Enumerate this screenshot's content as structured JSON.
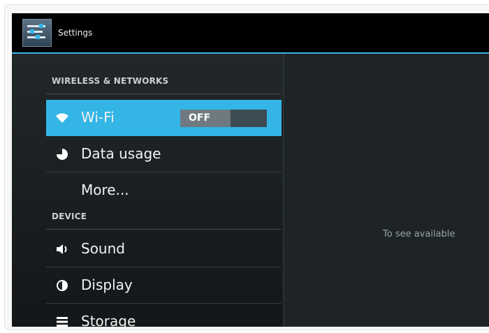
{
  "app": {
    "title": "Settings",
    "icon": "settings-icon"
  },
  "sections": {
    "wireless": {
      "header": "WIRELESS & NETWORKS"
    },
    "device": {
      "header": "DEVICE"
    }
  },
  "items": {
    "wifi": {
      "label": "Wi-Fi",
      "icon": "wifi-icon",
      "toggle": "OFF",
      "selected": true
    },
    "data_usage": {
      "label": "Data usage",
      "icon": "data-usage-icon"
    },
    "more": {
      "label": "More..."
    },
    "sound": {
      "label": "Sound",
      "icon": "speaker-icon"
    },
    "display": {
      "label": "Display",
      "icon": "display-icon"
    },
    "storage": {
      "label": "Storage",
      "icon": "storage-icon"
    }
  },
  "detail": {
    "hint": "To see available"
  },
  "colors": {
    "accent": "#33b5e5",
    "background": "#000000"
  }
}
